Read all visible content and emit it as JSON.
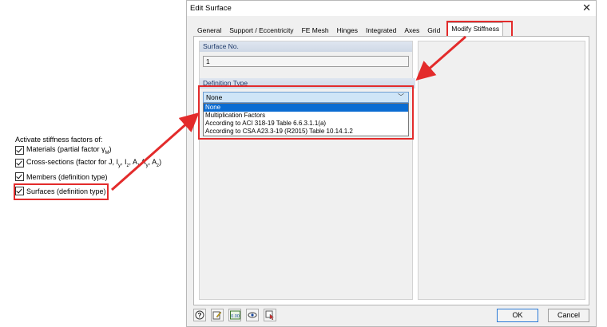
{
  "left_panel": {
    "heading": "Activate stiffness factors of:",
    "options": [
      {
        "label": "Materials (partial factor γ",
        "sub": "M",
        "tail": ")",
        "checked": true
      },
      {
        "label": "Cross-sections (factor for J, I",
        "sub": "y",
        "mid": ", I",
        "sub2": "z",
        "tail": ", A, A",
        "sub3": "y",
        "mid2": ", A",
        "sub4": "z",
        "tail2": ")",
        "checked": true
      },
      {
        "label": "Members (definition type)",
        "checked": true
      },
      {
        "label": "Surfaces (definition type)",
        "checked": true,
        "highlighted": true
      }
    ]
  },
  "dialog": {
    "title": "Edit Surface",
    "close_glyph": "✕",
    "tabs": [
      "General",
      "Support / Eccentricity",
      "FE Mesh",
      "Hinges",
      "Integrated",
      "Axes",
      "Grid",
      "Modify Stiffness"
    ],
    "active_tab": "Modify Stiffness",
    "surface_no_label": "Surface No.",
    "surface_no_value": "1",
    "definition_type_label": "Definition Type",
    "definition_type_value": "None",
    "dropdown_options": [
      "None",
      "Multiplication Factors",
      "According to ACI 318-19 Table 6.6.3.1.1(a)",
      "According to CSA A23.3-19 (R2015) Table 10.14.1.2"
    ],
    "selected_option": "None",
    "buttons": {
      "ok": "OK",
      "cancel": "Cancel"
    },
    "toolbar_icons": [
      "help-icon",
      "edit-icon",
      "units-icon",
      "view-icon",
      "select-icon"
    ],
    "units_icon_text": "0.00"
  },
  "annotation_color": "#e32b2b"
}
